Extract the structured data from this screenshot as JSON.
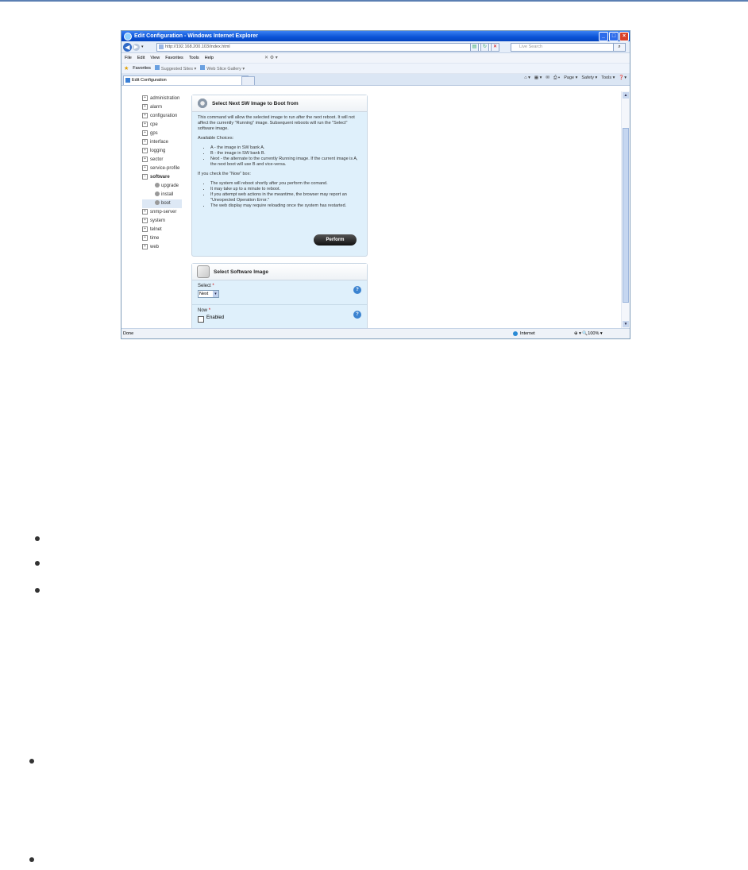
{
  "window": {
    "title": "Edit Configuration - Windows Internet Explorer",
    "url": "http://192.168.200.103/index.html",
    "search_placeholder": "Live Search"
  },
  "menu": [
    "File",
    "Edit",
    "View",
    "Favorites",
    "Tools",
    "Help"
  ],
  "favorites_bar": {
    "favorites_label": "Favorites",
    "suggested_sites": "Suggested Sites ▾",
    "web_slice_gallery": "Web Slice Gallery ▾"
  },
  "tab": {
    "label": "Edit Configuration"
  },
  "command_bar": [
    "Page ▾",
    "Safety ▾",
    "Tools ▾"
  ],
  "tree": {
    "items": [
      {
        "label": "administration",
        "exp": "+"
      },
      {
        "label": "alarm",
        "exp": "+"
      },
      {
        "label": "configuration",
        "exp": "+"
      },
      {
        "label": "cpe",
        "exp": "+"
      },
      {
        "label": "gps",
        "exp": "+"
      },
      {
        "label": "interface",
        "exp": "+"
      },
      {
        "label": "logging",
        "exp": "+"
      },
      {
        "label": "sector",
        "exp": "+"
      },
      {
        "label": "service-profile",
        "exp": "+"
      },
      {
        "label": "software",
        "exp": "−"
      }
    ],
    "software_children": [
      "upgrade",
      "install",
      "boot"
    ],
    "items_after": [
      {
        "label": "snmp-server",
        "exp": "+"
      },
      {
        "label": "system",
        "exp": "+"
      },
      {
        "label": "telnet",
        "exp": "+"
      },
      {
        "label": "time",
        "exp": "+"
      },
      {
        "label": "web",
        "exp": "+"
      }
    ]
  },
  "boot_panel": {
    "title": "Select Next SW Image to Boot from",
    "intro": "This command will allow the selected image to run after the next reboot. It will not affect the currently \"Running\" image. Subsequent reboots will run the \"Select\" software image.",
    "choices_heading": "Available Choices:",
    "choices": [
      "A - the image in SW bank A.",
      "B - the image in SW bank B.",
      "Next - the alternate to the currently Running image. If the current image is A, the next boot will use B and vice-versa."
    ],
    "now_heading": "If you check the \"Now\" box:",
    "now_items": [
      "The system will reboot shortly after you perform the comand.",
      "It may take up to a minute to reboot.",
      "If you attempt web actions in the meantime, the browser may report an \"Unexpected Operation Error.\"",
      "The web display may require reloading once the system has restarted."
    ],
    "perform_label": "Perform"
  },
  "image_panel": {
    "title": "Select Software Image",
    "select_label": "Select",
    "select_value": "Next",
    "now_label": "Now",
    "required_mark": "*",
    "enabled_label": "Enabled"
  },
  "status": {
    "left": "Done",
    "zone": "Internet",
    "zoom": "100%"
  }
}
